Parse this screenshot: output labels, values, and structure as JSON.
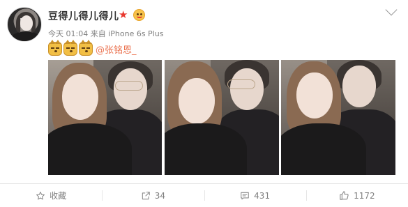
{
  "post": {
    "username": "豆得儿得儿得儿",
    "time": "今天 01:04",
    "source_prefix": "来自",
    "source_device": "iPhone 6s Plus",
    "mention": "@张铭恩_",
    "emoji_count": 3
  },
  "actions": {
    "favorite_label": "收藏",
    "repost_count": "34",
    "comment_count": "431",
    "like_count": "1172"
  },
  "colors": {
    "mention": "#eb7350",
    "meta_text": "#808080",
    "star_badge": "#e8392f"
  },
  "icons": {
    "favorite": "star-outline-icon",
    "repost": "share-arrow-icon",
    "comment": "comment-icon",
    "like": "thumbs-up-icon",
    "more": "chevron-down-icon"
  }
}
